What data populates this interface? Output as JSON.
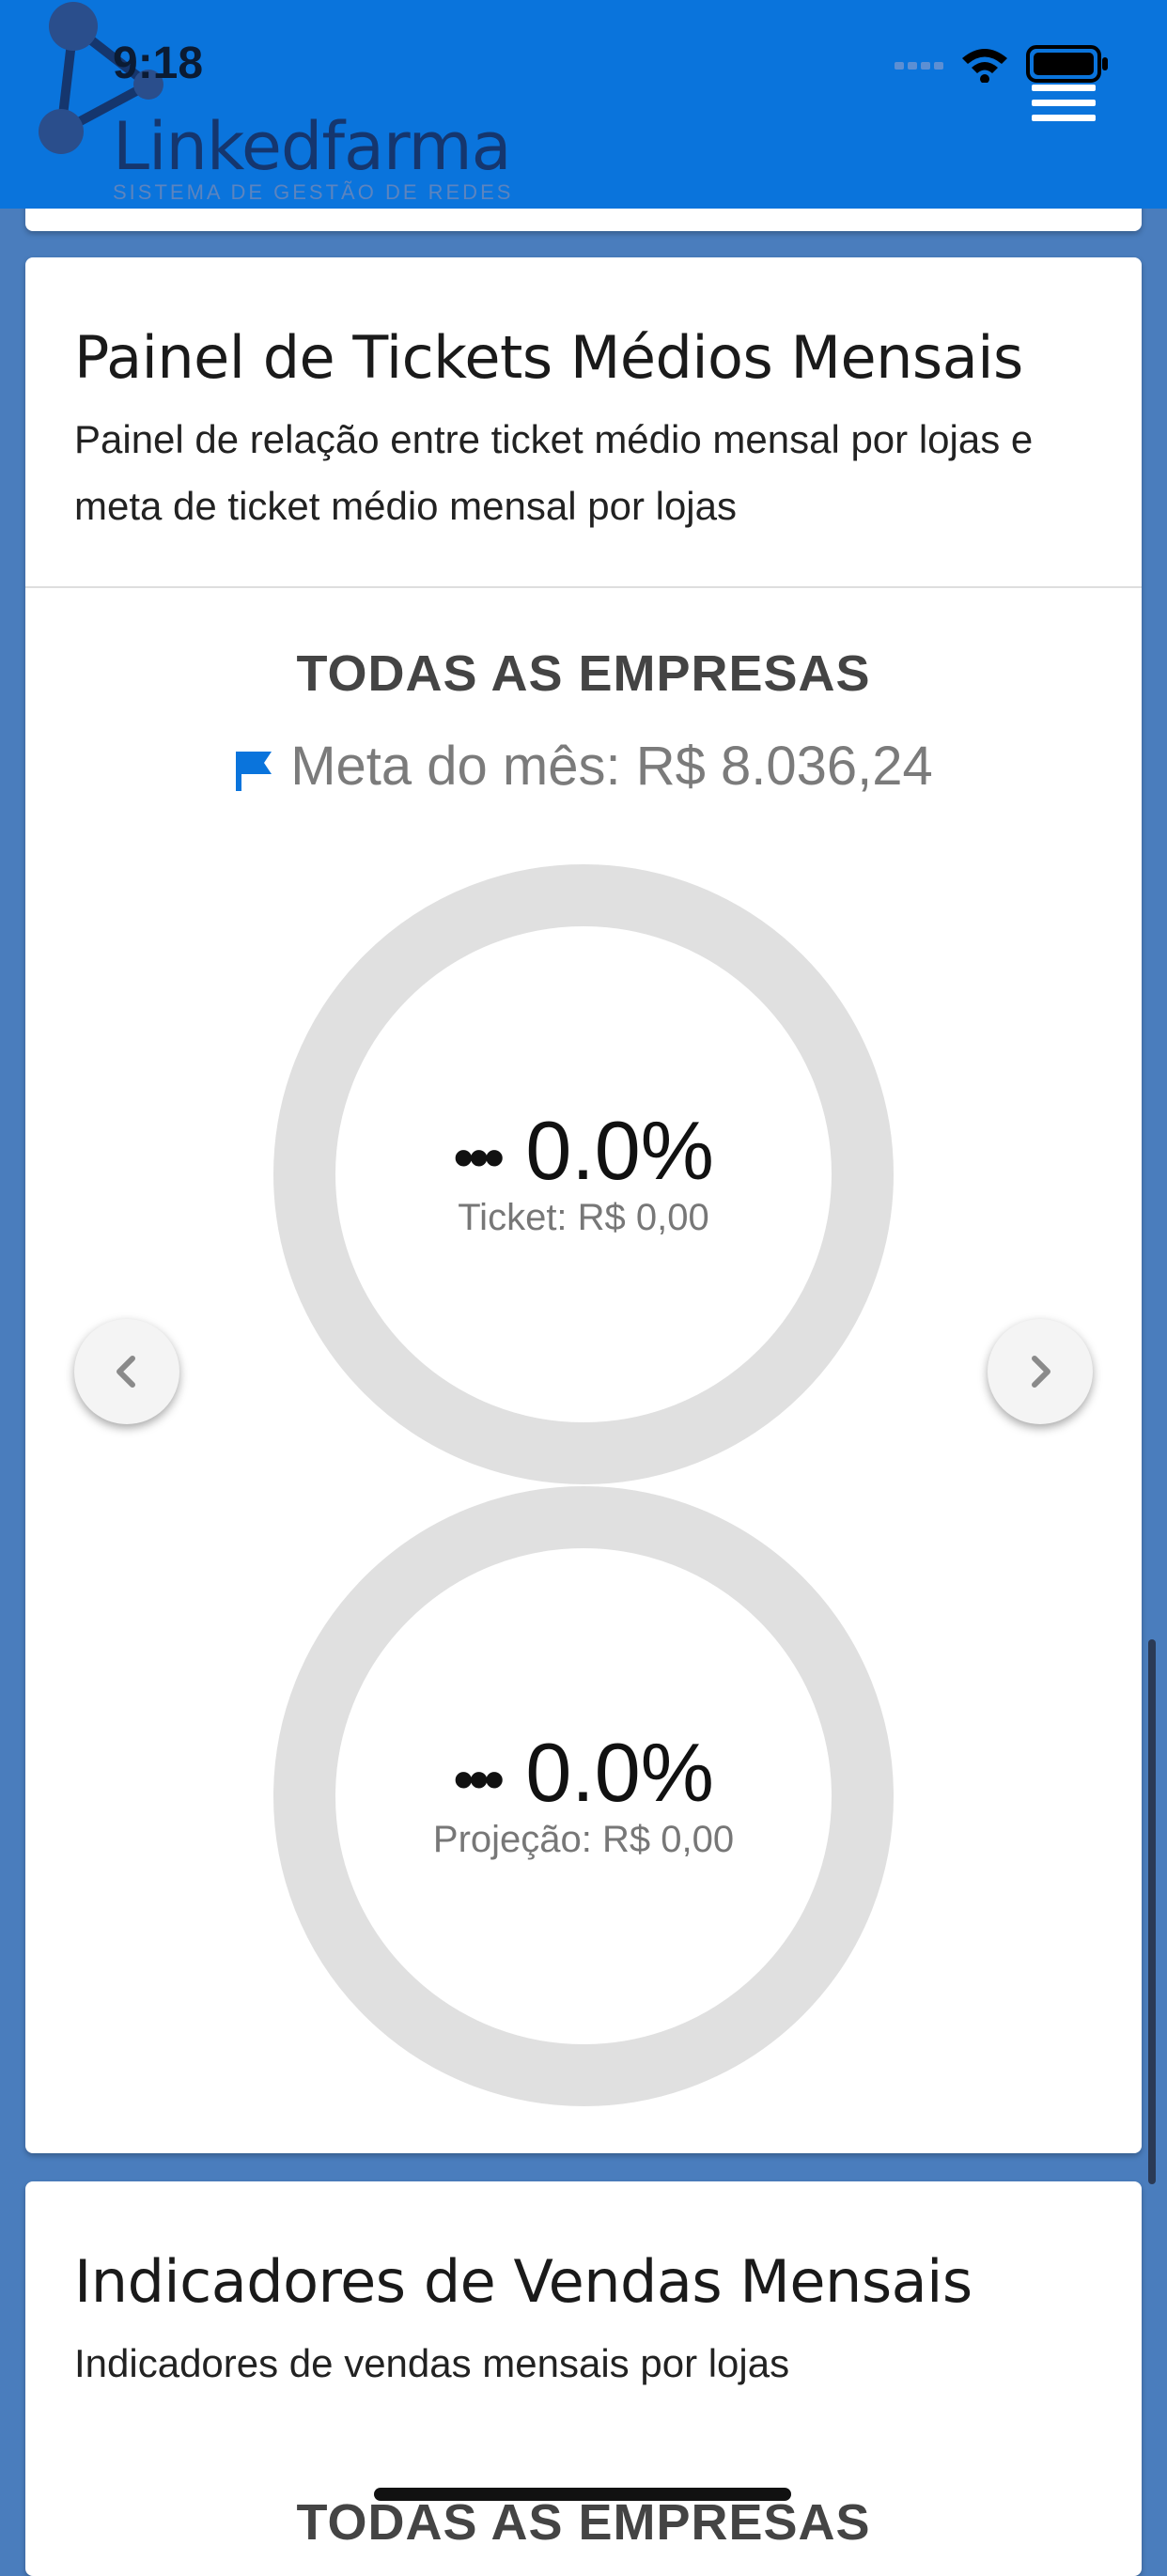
{
  "status_bar": {
    "time": "9:18"
  },
  "brand": {
    "name": "Linkedfarma",
    "tagline": "SISTEMA DE GESTÃO DE REDES"
  },
  "tickets_panel": {
    "title": "Painel de Tickets Médios Mensais",
    "description": "Painel de relação entre ticket médio mensal por lojas e meta de ticket médio mensal por lojas",
    "company": "TODAS AS EMPRESAS",
    "goal": "Meta do mês: R$ 8.036,24",
    "ticket_ring": {
      "percent": "0.0%",
      "label": "Ticket: R$ 0,00",
      "progress": 0
    },
    "projection_ring": {
      "percent": "0.0%",
      "label": "Projeção: R$ 0,00",
      "progress": 0
    }
  },
  "sales_panel": {
    "title": "Indicadores de Vendas Mensais",
    "description": "Indicadores de vendas mensais por lojas",
    "company": "TODAS AS EMPRESAS"
  },
  "colors": {
    "header": "#0a74dc",
    "background": "#4a7dbd",
    "ring_track": "#e0e0e0",
    "flag": "#0a74dc"
  },
  "icons": [
    "menu-icon",
    "wifi-icon",
    "battery-icon",
    "signal-icon",
    "flag-icon",
    "chevron-left-icon",
    "chevron-right-icon",
    "dots-icon"
  ]
}
